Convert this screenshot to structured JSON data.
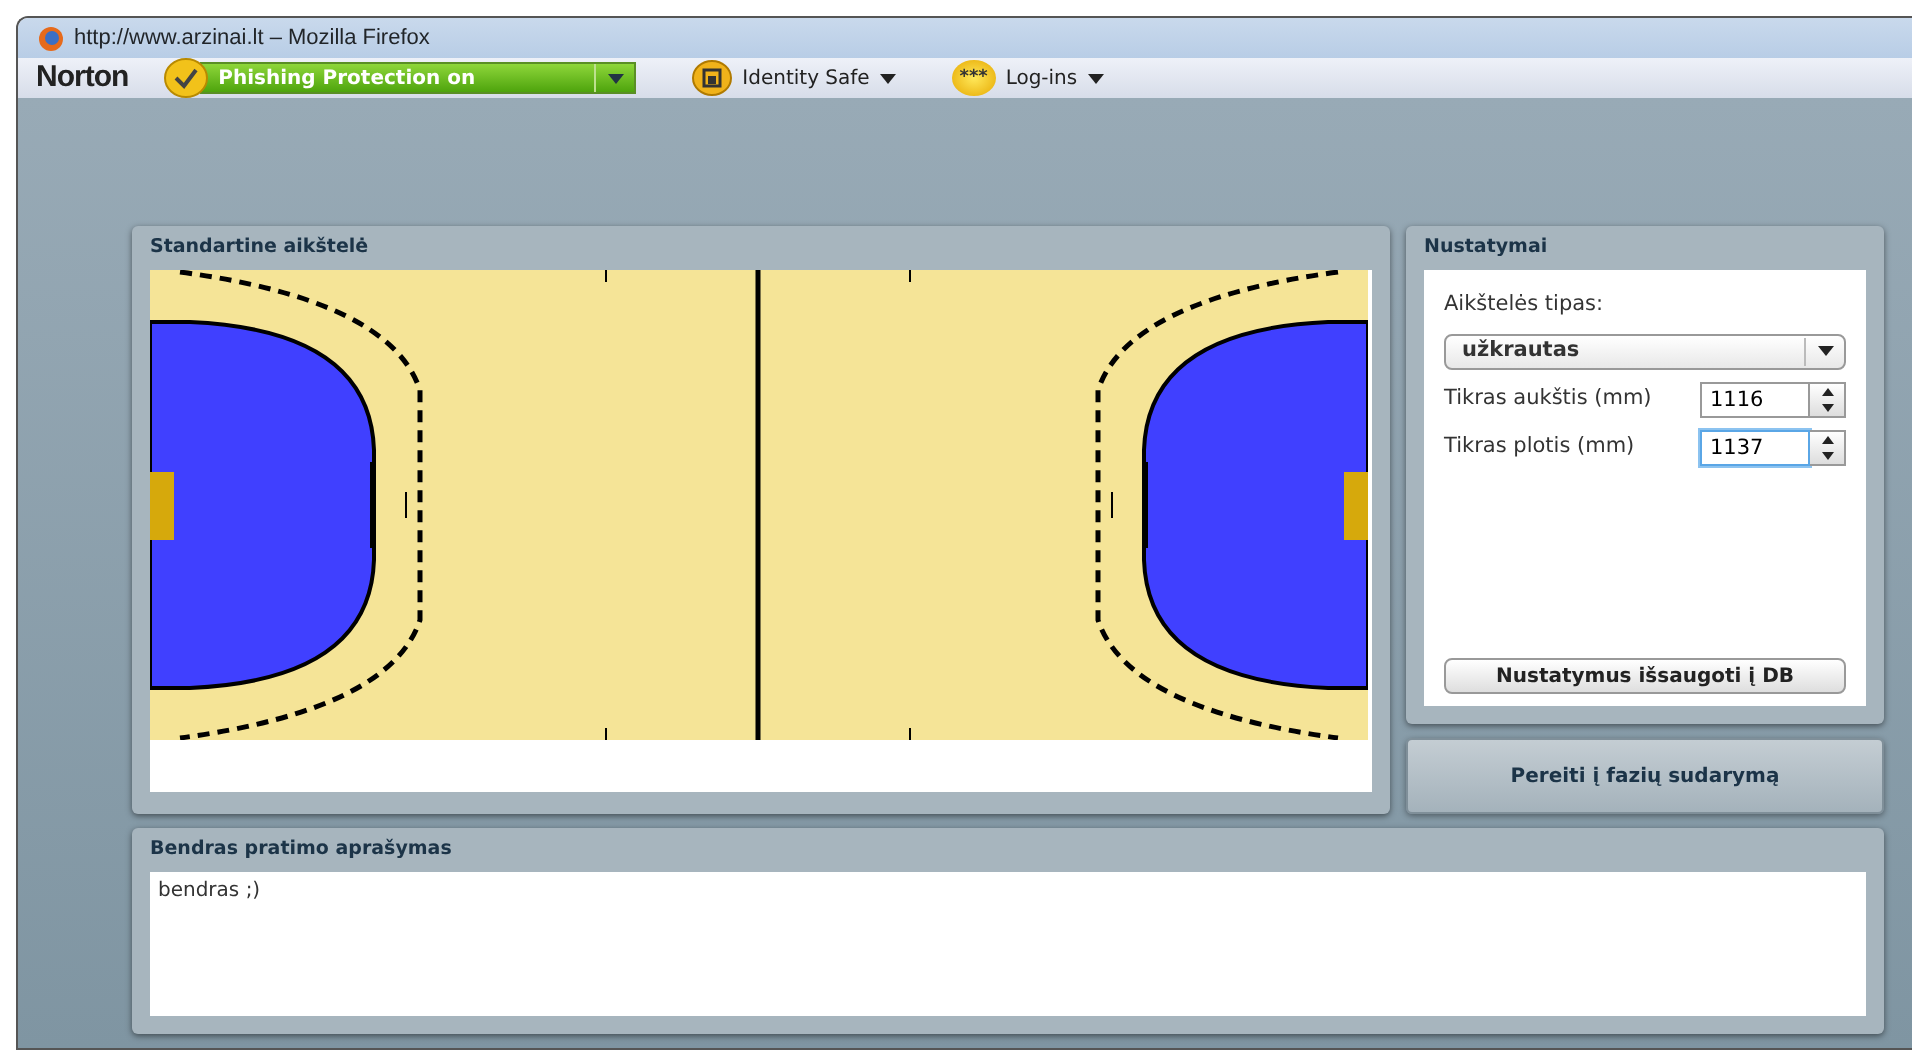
{
  "window": {
    "title": "http://www.arzinai.lt – Mozilla Firefox"
  },
  "toolbar": {
    "brand": "Norton",
    "phishing": {
      "label": "Phishing Protection on",
      "on": true
    },
    "menus": [
      {
        "kind": "lock",
        "label": "Identity Safe"
      },
      {
        "kind": "dots",
        "label": "Log-ins",
        "icon_text": "***"
      }
    ]
  },
  "court_panel": {
    "title": "Standartine aikštelė"
  },
  "settings": {
    "title": "Nustatymai",
    "type_label": "Aikštelės tipas:",
    "type_value": "užkrautas",
    "fields": [
      {
        "label": "Tikras aukštis (mm)",
        "value": "1116",
        "focused": false
      },
      {
        "label": "Tikras plotis (mm)",
        "value": "1137",
        "focused": true
      }
    ],
    "save_button": "Nustatymus išsaugoti į DB"
  },
  "next_button": "Pereiti į fazių sudarymą",
  "description": {
    "title": "Bendras pratimo aprašymas",
    "text": "bendras ;)"
  }
}
